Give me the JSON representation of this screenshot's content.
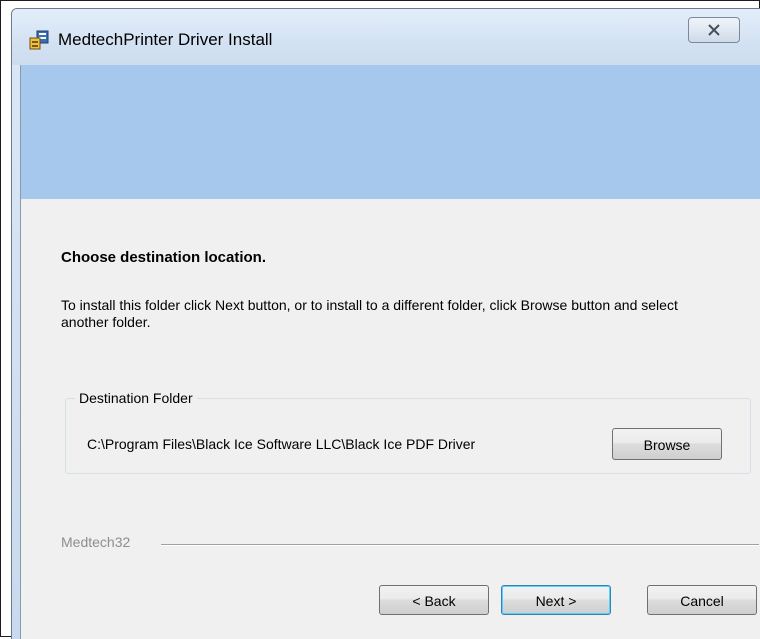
{
  "window": {
    "title": "MedtechPrinter Driver Install",
    "icon": "installer-icon",
    "close_icon": "close-icon"
  },
  "page": {
    "heading": "Choose destination location.",
    "description": "To install this folder click Next button, or to install to a different folder, click Browse button and select another folder."
  },
  "destination": {
    "legend": "Destination Folder",
    "path": "C:\\Program Files\\Black Ice Software LLC\\Black Ice PDF Driver",
    "browse_label": "Browse"
  },
  "footer": {
    "brand": "Medtech32",
    "back_label": "< Back",
    "next_label": "Next >",
    "cancel_label": "Cancel"
  },
  "colors": {
    "banner": "#a6c8ec",
    "client_background": "#f0f0f0",
    "default_button_border": "#3c7fb1"
  }
}
